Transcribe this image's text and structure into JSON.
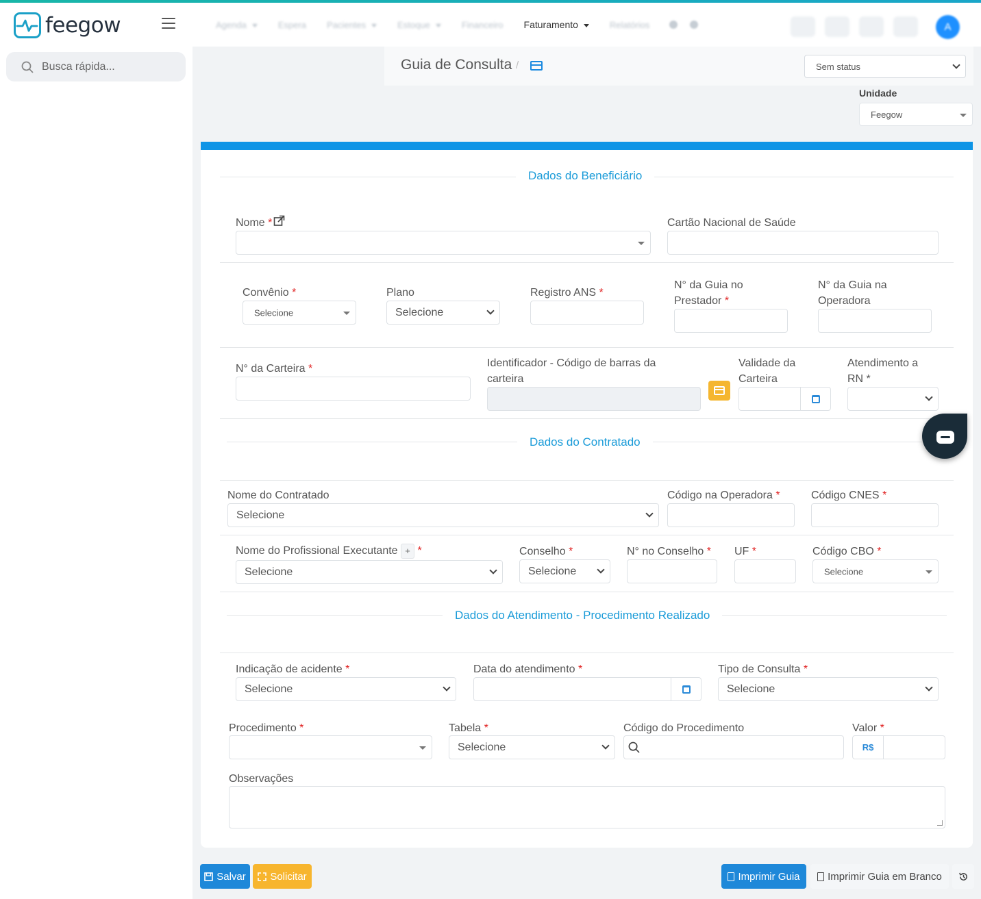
{
  "brand": {
    "name": "feegow",
    "accent": "#1aa0c7"
  },
  "nav": {
    "items": [
      {
        "label": "Agenda",
        "has_caret": true,
        "active": false
      },
      {
        "label": "Espera",
        "has_caret": false,
        "active": false
      },
      {
        "label": "Pacientes",
        "has_caret": true,
        "active": false
      },
      {
        "label": "Estoque",
        "has_caret": true,
        "active": false
      },
      {
        "label": "Financeiro",
        "has_caret": false,
        "active": false
      },
      {
        "label": "Faturamento",
        "has_caret": true,
        "active": true
      },
      {
        "label": "Relatórios",
        "has_caret": false,
        "active": false
      }
    ],
    "avatar_initial": "A"
  },
  "sidebar": {
    "search_placeholder": "Busca rápida..."
  },
  "header": {
    "title": "Guia de Consulta",
    "separator": "/",
    "status": "Sem status",
    "unidade_label": "Unidade",
    "unidade_value": "Feegow"
  },
  "beneficiario": {
    "title": "Dados do Beneficiário",
    "nome": "Nome",
    "cartao": "Cartão Nacional de Saúde",
    "convenio": "Convênio",
    "convenio_value": "Selecione",
    "plano": "Plano",
    "plano_value": "Selecione",
    "registro_ans": "Registro ANS",
    "guia_prestador_1": "N° da Guia no",
    "guia_prestador_2": "Prestador",
    "guia_operadora_1": "N° da Guia na",
    "guia_operadora_2": "Operadora",
    "carteira": "N° da Carteira",
    "identificador_1": "Identificador - Código de barras da",
    "identificador_2": "carteira",
    "validade_1": "Validade da",
    "validade_2": "Carteira",
    "rn_1": "Atendimento a",
    "rn_2": "RN *"
  },
  "contratado": {
    "title": "Dados do Contratado",
    "nome": "Nome do Contratado",
    "nome_value": "Selecione",
    "codigo_operadora": "Código na Operadora",
    "cnes": "Código CNES",
    "profissional": "Nome do Profissional Executante",
    "profissional_value": "Selecione",
    "conselho": "Conselho",
    "conselho_value": "Selecione",
    "n_conselho": "N° no Conselho",
    "uf": "UF",
    "cbo": "Código CBO",
    "cbo_value": "Selecione"
  },
  "atendimento": {
    "title": "Dados do Atendimento - Procedimento Realizado",
    "acidente": "Indicação de acidente",
    "acidente_value": "Selecione",
    "data": "Data do atendimento",
    "tipo": "Tipo de Consulta",
    "tipo_value": "Selecione",
    "procedimento": "Procedimento",
    "tabela": "Tabela",
    "tabela_value": "Selecione",
    "codigo": "Código do Procedimento",
    "valor": "Valor",
    "currency": "R$",
    "observacoes": "Observações"
  },
  "actions": {
    "salvar": "Salvar",
    "solicitar": "Solicitar",
    "imprimir": "Imprimir Guia",
    "imprimir_branco": "Imprimir Guia em Branco"
  },
  "common": {
    "required_mark": "*",
    "plus": "+"
  }
}
